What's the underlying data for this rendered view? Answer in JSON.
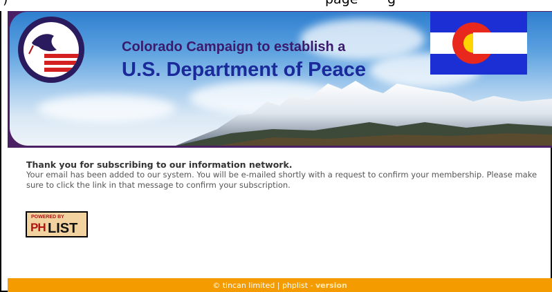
{
  "header": {
    "line1": "Colorado Campaign to establish a",
    "line2": "U.S. Department of Peace"
  },
  "message": {
    "heading": "Thank you for subscribing to our information network.",
    "body": "Your email has been added to our system. You will be e-mailed shortly with a request to confirm your membership. Please make sure to click the link in that message to confirm your subscription."
  },
  "badge": {
    "powered_by": "POWERED BY",
    "ph": "PH",
    "list": "LIST"
  },
  "footer": {
    "copyright": "© tincan limited",
    "separator": " | ",
    "app": "phplist",
    "dash": " - ",
    "version": "version"
  },
  "colors": {
    "footer_bg": "#f49b00",
    "banner_border": "#4b1f63",
    "title_blue": "#1b2a9a"
  }
}
